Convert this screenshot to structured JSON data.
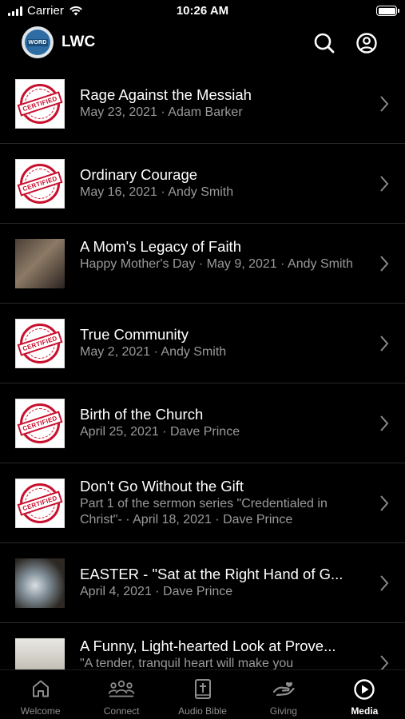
{
  "status": {
    "carrier": "Carrier",
    "time": "10:26 AM"
  },
  "header": {
    "logo_text": "WORD",
    "title": "LWC"
  },
  "sermons": [
    {
      "title": "Rage Against the Messiah",
      "subtitle": "May 23, 2021 · Adam Barker",
      "thumb": "certified-stamp"
    },
    {
      "title": "Ordinary Courage",
      "subtitle": "May 16, 2021 · Andy Smith",
      "thumb": "certified-stamp"
    },
    {
      "title": "A Mom's Legacy of Faith",
      "subtitle": "Happy Mother's Day · May 9, 2021 · Andy Smith",
      "thumb": "photo"
    },
    {
      "title": "True Community",
      "subtitle": "May 2, 2021 · Andy Smith",
      "thumb": "certified-stamp"
    },
    {
      "title": "Birth of the Church",
      "subtitle": "April 25, 2021 · Dave Prince",
      "thumb": "certified-stamp"
    },
    {
      "title": "Don't Go Without the Gift",
      "subtitle": "Part 1 of the sermon series \"Credentialed in Christ\"- · April 18, 2021 · Dave Prince",
      "thumb": "certified-stamp"
    },
    {
      "title": "EASTER - \"Sat at the Right Hand of G...",
      "subtitle": "April 4, 2021 · Dave Prince",
      "thumb": "photo"
    },
    {
      "title": "A Funny, Light-hearted Look at Prove...",
      "subtitle": "\"A tender, tranquil heart will make you",
      "thumb": "photo"
    }
  ],
  "cert_label": "CERTIFIED",
  "tabs": [
    {
      "label": "Welcome",
      "icon": "home-icon"
    },
    {
      "label": "Connect",
      "icon": "people-icon"
    },
    {
      "label": "Audio Bible",
      "icon": "bible-icon"
    },
    {
      "label": "Giving",
      "icon": "giving-hand-icon"
    },
    {
      "label": "Media",
      "icon": "play-circle-icon",
      "active": true
    }
  ]
}
